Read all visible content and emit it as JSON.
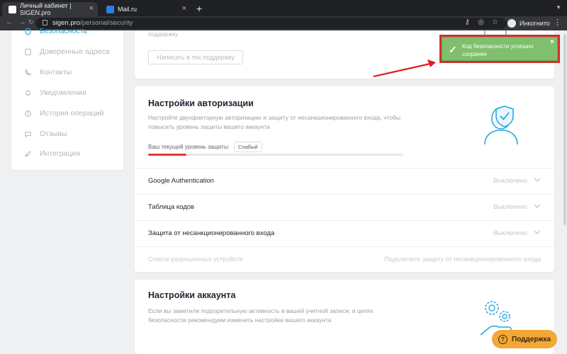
{
  "browser": {
    "tabs": [
      {
        "title": "Личный кабинет | SIGEN.pro",
        "active": true
      },
      {
        "title": "Mail.ru",
        "active": false
      }
    ],
    "new_tab": "+",
    "close": "×",
    "url_host": "sigen.pro",
    "url_path": "/personal/security",
    "profile_label": "Инкогнито"
  },
  "sidebar": {
    "items": [
      {
        "label": "Безопасность",
        "icon": "shield-icon",
        "active": true
      },
      {
        "label": "Доверенные адреса",
        "icon": "book-icon"
      },
      {
        "label": "Контакты",
        "icon": "phone-icon"
      },
      {
        "label": "Уведомления",
        "icon": "bell-icon"
      },
      {
        "label": "История операций",
        "icon": "history-icon"
      },
      {
        "label": "Отзывы",
        "icon": "chat-icon"
      },
      {
        "label": "Интеграция",
        "icon": "rocket-icon"
      }
    ]
  },
  "support_card": {
    "text_fragment": "поддержку",
    "button_label": "Написать в тех.поддержку"
  },
  "auth_card": {
    "title": "Настройки авторизации",
    "description": "Настройте двухфакторную авторизацию и защиту от несанкционированного входа, чтобы повысить уровень защиты вашего аккаунта",
    "level_label": "Ваш текущий уровень защиты:",
    "level_value": "Слабый",
    "level_fraction": 0.15,
    "rows": [
      {
        "label": "Google Authentication",
        "status": "Выключено"
      },
      {
        "label": "Таблица кодов",
        "status": "Выключено"
      },
      {
        "label": "Защита от несанкционированного входа",
        "status": "Выключено"
      }
    ],
    "devices_label": "Список разрешенных устройств",
    "devices_link": "Подключите защиту от несанкционированного входа"
  },
  "account_card": {
    "title": "Настройки аккаунта",
    "description": "Если вы заметили подозрительную активность в вашей учетной записи, в целях безопасности рекомендуем изменить настройки вашего аккаунта"
  },
  "toast": {
    "message": "Код безопасности успешно сохранен",
    "close": "×"
  },
  "help_button": {
    "label": "Поддержка",
    "icon": "?"
  },
  "colors": {
    "accent": "#29a8e0",
    "toast_bg": "#7fbf6e",
    "highlight": "#d32f2f",
    "danger": "#e53935",
    "help": "#f4a736"
  }
}
